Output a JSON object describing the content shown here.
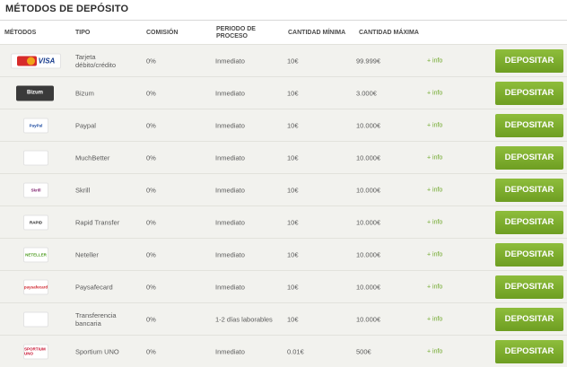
{
  "title": "MÉTODOS DE DEPÓSITO",
  "headers": {
    "metodos": "MÉTODOS",
    "tipo": "TIPO",
    "comision": "COMISIÓN",
    "periodo": "PERIODO DE PROCESO",
    "min": "CANTIDAD MÍNIMA",
    "max": "CANTIDAD MÁXIMA"
  },
  "colors": {
    "accent": "#7aab2c",
    "info": "#6fa82a",
    "row_bg": "#f2f2ee"
  },
  "rows": [
    {
      "logo_text": "VISA",
      "logo_icon": "mastercard-visa-icon",
      "tipo": "Tarjeta débito/crédito",
      "comision": "0%",
      "periodo": "Inmediato",
      "min": "10€",
      "max": "99.999€",
      "info": "+ info",
      "button": "DEPOSITAR"
    },
    {
      "logo_text": "Bizum",
      "logo_icon": "bizum-icon",
      "tipo": "Bizum",
      "comision": "0%",
      "periodo": "Inmediato",
      "min": "10€",
      "max": "3.000€",
      "info": "+ info",
      "button": "DEPOSITAR"
    },
    {
      "logo_text": "PayPal",
      "logo_icon": "paypal-icon",
      "tipo": "Paypal",
      "comision": "0%",
      "periodo": "Inmediato",
      "min": "10€",
      "max": "10.000€",
      "info": "+ info",
      "button": "DEPOSITAR"
    },
    {
      "logo_text": "",
      "logo_icon": "muchbetter-icon",
      "tipo": "MuchBetter",
      "comision": "0%",
      "periodo": "Inmediato",
      "min": "10€",
      "max": "10.000€",
      "info": "+ info",
      "button": "DEPOSITAR"
    },
    {
      "logo_text": "Skrill",
      "logo_icon": "skrill-icon",
      "tipo": "Skrill",
      "comision": "0%",
      "periodo": "Inmediato",
      "min": "10€",
      "max": "10.000€",
      "info": "+ info",
      "button": "DEPOSITAR"
    },
    {
      "logo_text": "RAPID",
      "logo_icon": "rapid-transfer-icon",
      "tipo": "Rapid Transfer",
      "comision": "0%",
      "periodo": "Inmediato",
      "min": "10€",
      "max": "10.000€",
      "info": "+ info",
      "button": "DEPOSITAR"
    },
    {
      "logo_text": "NETELLER",
      "logo_icon": "neteller-icon",
      "tipo": "Neteller",
      "comision": "0%",
      "periodo": "Inmediato",
      "min": "10€",
      "max": "10.000€",
      "info": "+ info",
      "button": "DEPOSITAR"
    },
    {
      "logo_text": "paysafecard",
      "logo_icon": "paysafecard-icon",
      "tipo": "Paysafecard",
      "comision": "0%",
      "periodo": "Inmediato",
      "min": "10€",
      "max": "10.000€",
      "info": "+ info",
      "button": "DEPOSITAR"
    },
    {
      "logo_text": "",
      "logo_icon": "bank-transfer-icon",
      "tipo": "Transferencia bancaria",
      "comision": "0%",
      "periodo": "1-2 días laborables",
      "min": "10€",
      "max": "10.000€",
      "info": "+ info",
      "button": "DEPOSITAR"
    },
    {
      "logo_text": "SPORTIUM UNO",
      "logo_icon": "sportium-uno-icon",
      "tipo": "Sportium UNO",
      "comision": "0%",
      "periodo": "Inmediato",
      "min": "0.01€",
      "max": "500€",
      "info": "+ info",
      "button": "DEPOSITAR"
    }
  ]
}
